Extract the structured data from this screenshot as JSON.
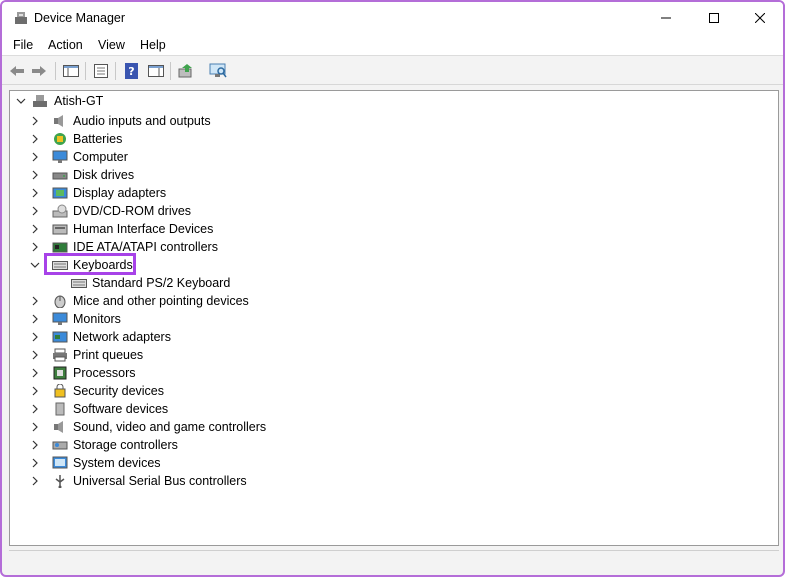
{
  "window": {
    "title": "Device Manager",
    "title_icon": "device-manager-icon"
  },
  "menu": {
    "items": [
      "File",
      "Action",
      "View",
      "Help"
    ]
  },
  "toolbar": {
    "buttons": [
      "back-arrow-icon",
      "forward-arrow-icon",
      "show-hide-console-tree-icon",
      "properties-icon",
      "help-icon",
      "action-pane-icon",
      "update-driver-icon",
      "scan-hardware-icon"
    ]
  },
  "tree": {
    "root": "Atish-GT",
    "nodes": [
      {
        "label": "Audio inputs and outputs",
        "icon": "speaker-icon"
      },
      {
        "label": "Batteries",
        "icon": "battery-icon"
      },
      {
        "label": "Computer",
        "icon": "monitor-icon"
      },
      {
        "label": "Disk drives",
        "icon": "disk-drive-icon"
      },
      {
        "label": "Display adapters",
        "icon": "display-adapter-icon"
      },
      {
        "label": "DVD/CD-ROM drives",
        "icon": "dvd-drive-icon"
      },
      {
        "label": "Human Interface Devices",
        "icon": "hid-icon"
      },
      {
        "label": "IDE ATA/ATAPI controllers",
        "icon": "ide-controller-icon"
      },
      {
        "label": "Keyboards",
        "icon": "keyboard-icon",
        "expanded": true,
        "children": [
          {
            "label": "Standard PS/2 Keyboard",
            "icon": "keyboard-icon"
          }
        ]
      },
      {
        "label": "Mice and other pointing devices",
        "icon": "mouse-icon"
      },
      {
        "label": "Monitors",
        "icon": "monitor-icon"
      },
      {
        "label": "Network adapters",
        "icon": "network-icon"
      },
      {
        "label": "Print queues",
        "icon": "printer-icon"
      },
      {
        "label": "Processors",
        "icon": "processor-icon"
      },
      {
        "label": "Security devices",
        "icon": "security-icon"
      },
      {
        "label": "Software devices",
        "icon": "software-device-icon"
      },
      {
        "label": "Sound, video and game controllers",
        "icon": "speaker-icon"
      },
      {
        "label": "Storage controllers",
        "icon": "storage-icon"
      },
      {
        "label": "System devices",
        "icon": "system-device-icon"
      },
      {
        "label": "Universal Serial Bus controllers",
        "icon": "usb-icon"
      }
    ]
  },
  "colors": {
    "highlight_border": "#a742e8",
    "window_border": "#b46dd8"
  }
}
